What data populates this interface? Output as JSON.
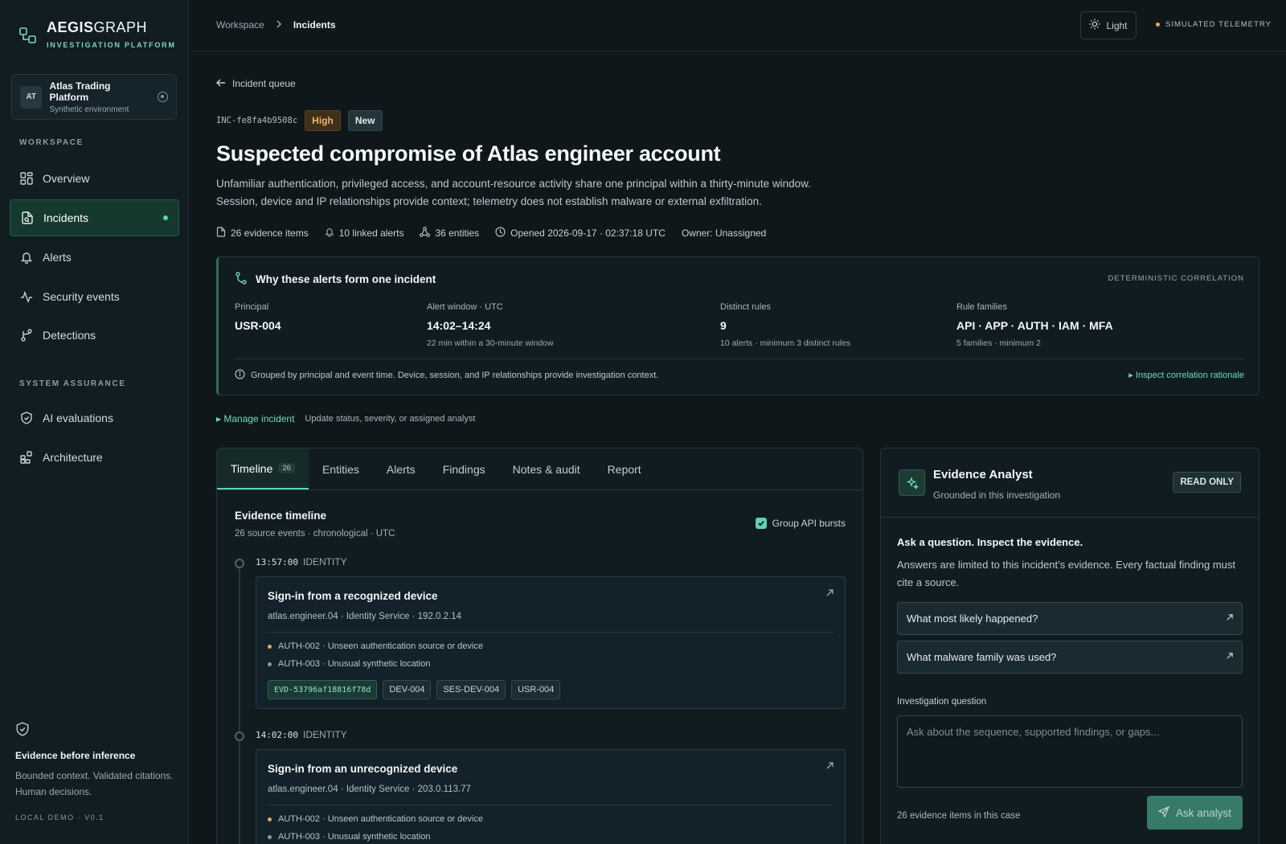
{
  "brand": {
    "name_bold": "AEGIS",
    "name_light": "GRAPH",
    "subtitle": "INVESTIGATION PLATFORM"
  },
  "tenant": {
    "initials": "AT",
    "name": "Atlas Trading Platform",
    "environment": "Synthetic environment"
  },
  "sidebar": {
    "workspace_label": "WORKSPACE",
    "assurance_label": "SYSTEM ASSURANCE",
    "items": [
      {
        "label": "Overview",
        "icon": "grid-icon"
      },
      {
        "label": "Incidents",
        "icon": "document-search-icon",
        "active": true
      },
      {
        "label": "Alerts",
        "icon": "bell-icon"
      },
      {
        "label": "Security events",
        "icon": "activity-icon"
      },
      {
        "label": "Detections",
        "icon": "branch-icon"
      }
    ],
    "assurance_items": [
      {
        "label": "AI evaluations",
        "icon": "shield-check-icon"
      },
      {
        "label": "Architecture",
        "icon": "blocks-icon"
      }
    ],
    "footer": {
      "title": "Evidence before inference",
      "text": "Bounded context. Validated citations. Human decisions.",
      "version": "LOCAL DEMO · V0.1"
    }
  },
  "topbar": {
    "breadcrumb": [
      "Workspace",
      "Incidents"
    ],
    "theme_label": "Light",
    "telemetry_label": "SIMULATED TELEMETRY",
    "telemetry_color": "#e6a95a"
  },
  "incident": {
    "back_label": "Incident queue",
    "id": "INC-fe8fa4b9508c",
    "severity": "High",
    "status": "New",
    "title": "Suspected compromise of Atlas engineer account",
    "description_1": "Unfamiliar authentication, privileged access, and account-resource activity share one principal within a thirty-minute window.",
    "description_2": "Session, device and IP relationships provide context; telemetry does not establish malware or external exfiltration.",
    "meta": {
      "evidence": "26 evidence items",
      "alerts": "10 linked alerts",
      "entities": "36 entities",
      "opened": "Opened 2026-09-17 · 02:37:18 UTC",
      "owner": "Owner: Unassigned"
    }
  },
  "correlation": {
    "title": "Why these alerts form one incident",
    "tag": "DETERMINISTIC CORRELATION",
    "principal_label": "Principal",
    "principal_value": "USR-004",
    "window_label": "Alert window · UTC",
    "window_value": "14:02–14:24",
    "window_sub": "22 min within a 30-minute window",
    "rules_label": "Distinct rules",
    "rules_value": "9",
    "rules_sub": "10 alerts · minimum 3 distinct rules",
    "families_label": "Rule families",
    "families_value": "API · APP · AUTH · IAM · MFA",
    "families_sub": "5 families · minimum 2",
    "note": "Grouped by principal and event time. Device, session, and IP relationships provide investigation context.",
    "link": "Inspect correlation rationale"
  },
  "manage": {
    "link": "Manage incident",
    "hint": "Update status, severity, or assigned analyst"
  },
  "tabs": [
    {
      "label": "Timeline",
      "count": "26",
      "active": true
    },
    {
      "label": "Entities"
    },
    {
      "label": "Alerts"
    },
    {
      "label": "Findings"
    },
    {
      "label": "Notes & audit"
    },
    {
      "label": "Report"
    }
  ],
  "timeline": {
    "title": "Evidence timeline",
    "subtitle": "26 source events · chronological · UTC",
    "group_label": "Group API bursts",
    "group_checked": true,
    "events": [
      {
        "time": "13:57:00",
        "category": "IDENTITY",
        "title": "Sign-in from a recognized device",
        "source": "atlas.engineer.04 · Identity Service · 192.0.2.14",
        "alerts": [
          {
            "text": "AUTH-002 · Unseen authentication source or device",
            "color": "#e6a95a"
          },
          {
            "text": "AUTH-003 · Unusual synthetic location",
            "color": "#8a9aa0"
          }
        ],
        "chips": [
          "EVD-53796af18816f78d",
          "DEV-004",
          "SES-DEV-004",
          "USR-004"
        ]
      },
      {
        "time": "14:02:00",
        "category": "IDENTITY",
        "title": "Sign-in from an unrecognized device",
        "source": "atlas.engineer.04 · Identity Service · 203.0.113.77",
        "alerts": [
          {
            "text": "AUTH-002 · Unseen authentication source or device",
            "color": "#e6a95a"
          },
          {
            "text": "AUTH-003 · Unusual synthetic location",
            "color": "#8a9aa0"
          }
        ]
      }
    ]
  },
  "analyst": {
    "title": "Evidence Analyst",
    "subtitle": "Grounded in this investigation",
    "badge": "READ ONLY",
    "prompt_title": "Ask a question. Inspect the evidence.",
    "prompt_desc": "Answers are limited to this incident’s evidence. Every factual finding must cite a source.",
    "suggestions": [
      "What most likely happened?",
      "What malware family was used?"
    ],
    "input_label": "Investigation question",
    "input_placeholder": "Ask about the sequence, supported findings, or gaps...",
    "evidence_count": "26 evidence items in this case",
    "button_label": "Ask analyst"
  },
  "colors": {
    "accent": "#5fd3b0",
    "high": "#f1b262",
    "bg": "#0f171b"
  }
}
